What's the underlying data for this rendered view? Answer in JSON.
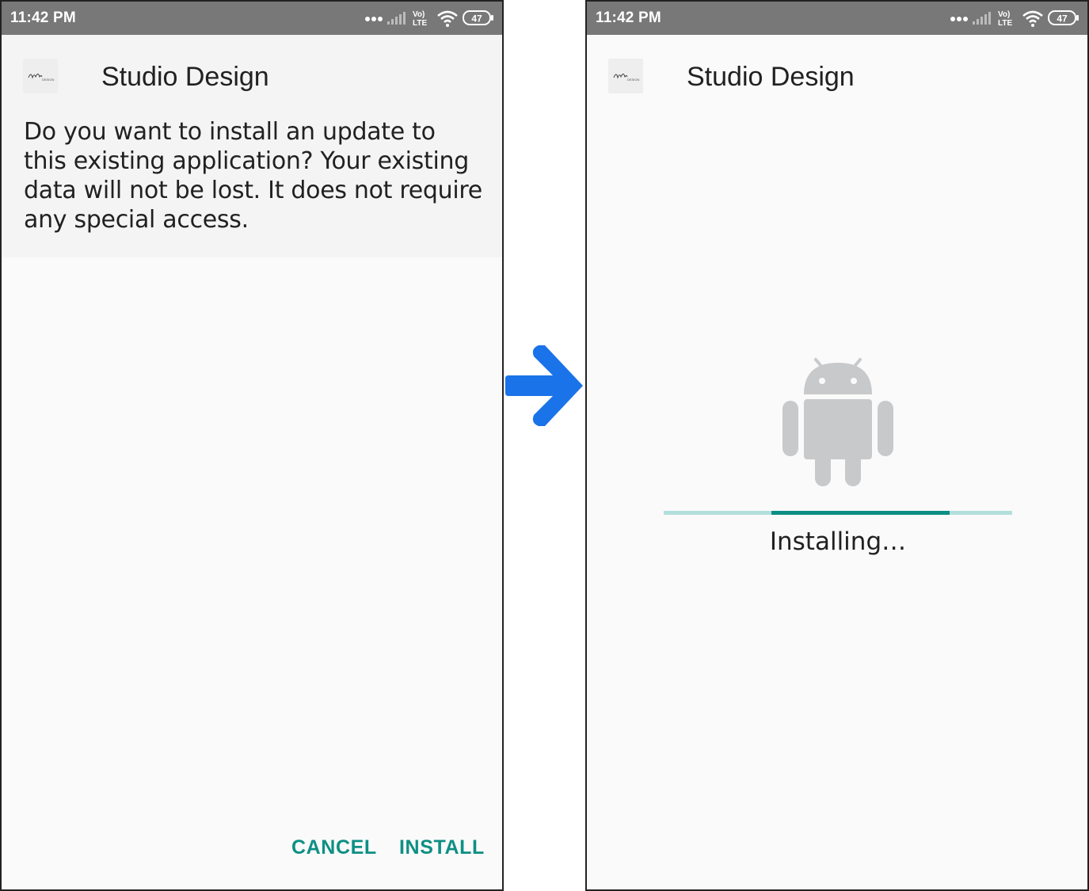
{
  "left_screen": {
    "status_bar": {
      "time": "11:42 PM",
      "network": "LTE",
      "volte": "Vo)",
      "battery": "47"
    },
    "app": {
      "title": "Studio Design",
      "icon": "studio-design-logo"
    },
    "dialog": {
      "message": "Do you want to install an update to this existing application? Your existing data will not be lost. It does not require any special access."
    },
    "buttons": {
      "cancel": "CANCEL",
      "install": "INSTALL"
    }
  },
  "transition": {
    "icon": "arrow-right-icon",
    "color": "#1a73e8"
  },
  "right_screen": {
    "status_bar": {
      "time": "11:42 PM",
      "network": "LTE",
      "volte": "Vo)",
      "battery": "47"
    },
    "app": {
      "title": "Studio Design",
      "icon": "studio-design-logo"
    },
    "progress": {
      "status_text": "Installing…",
      "indeterminate_segment_start": 0.31,
      "indeterminate_segment_end": 0.82
    },
    "illustration": "android-robot-icon"
  },
  "colors": {
    "status_bar": "#787878",
    "accent": "#0e8f84",
    "progress_track": "#b2dfdb",
    "android_gray": "#c8c9cb",
    "arrow": "#1a73e8"
  }
}
